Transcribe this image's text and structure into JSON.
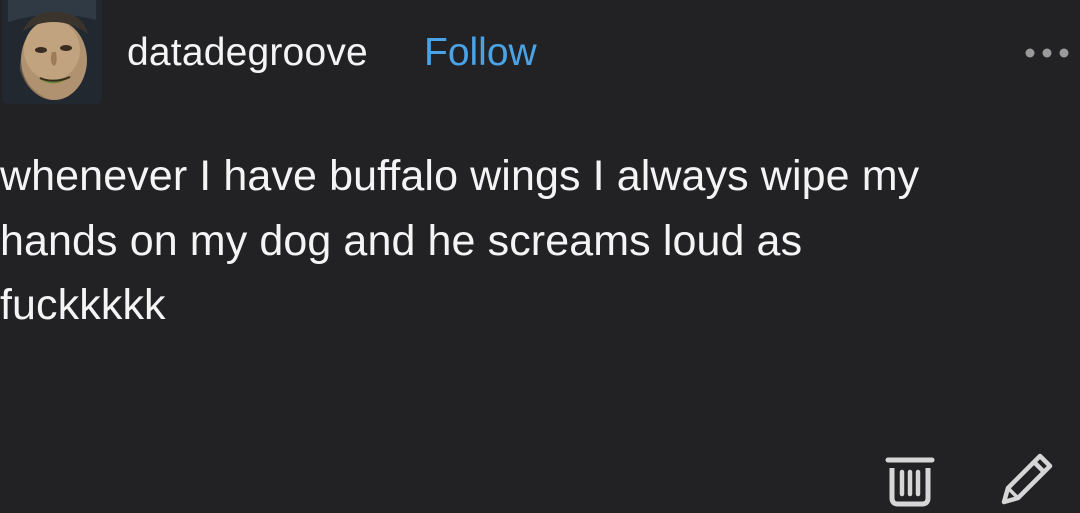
{
  "post": {
    "author": {
      "username": "datadegroove",
      "follow_label": "Follow"
    },
    "body": "whenever I have buffalo wings I always wipe my\nhands on my dog and he screams loud as\nfuckkkkk"
  },
  "icons": {
    "more": "more-horizontal-icon",
    "delete": "trash-icon",
    "edit": "pencil-icon"
  },
  "colors": {
    "background": "#222224",
    "text": "#f4f4f4",
    "accent": "#4aa3e6"
  }
}
